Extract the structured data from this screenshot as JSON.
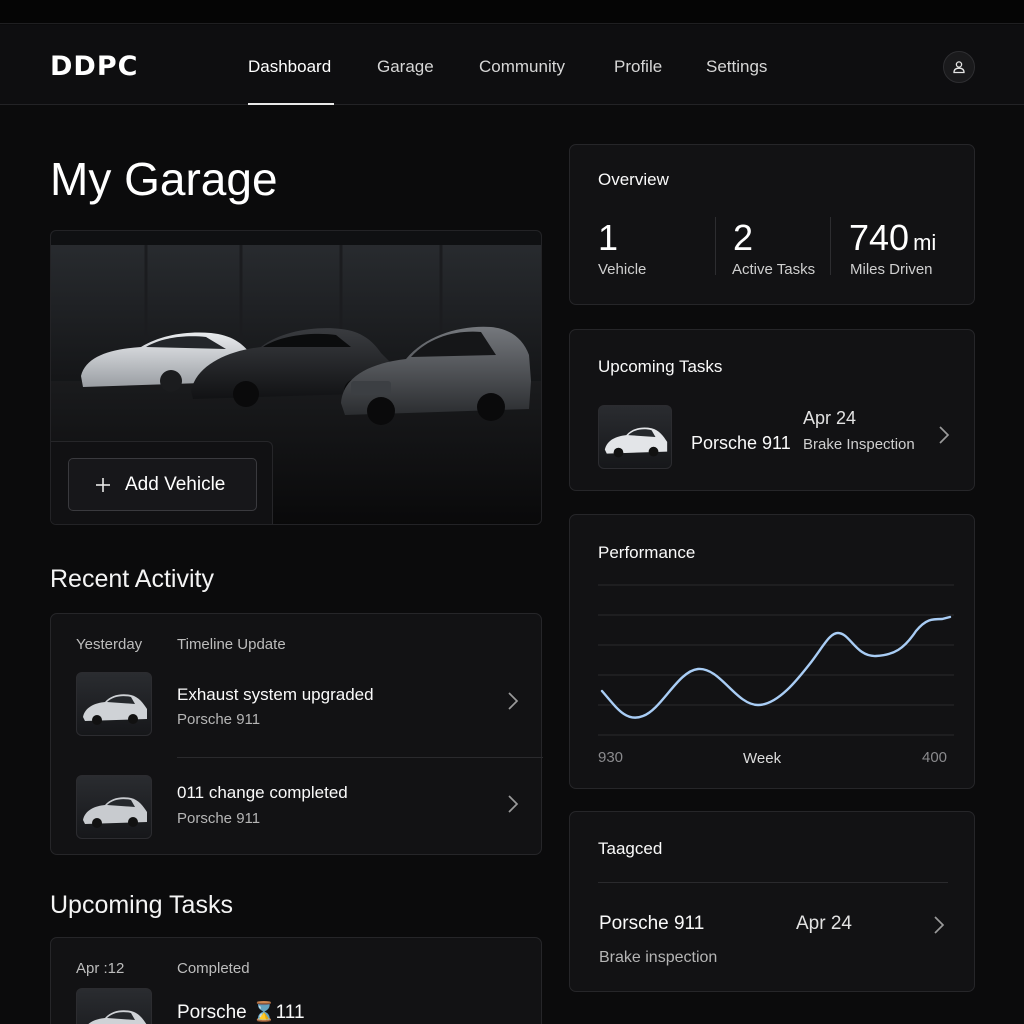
{
  "app": {
    "logo": "DDPC"
  },
  "nav": {
    "items": [
      {
        "label": "Dashboard",
        "active": true
      },
      {
        "label": "Garage"
      },
      {
        "label": "Community"
      },
      {
        "label": "Profile"
      },
      {
        "label": "Settings"
      }
    ],
    "profile_icon": "user-icon"
  },
  "page": {
    "title": "My Garage"
  },
  "hero": {
    "add_button": "Add Vehicle",
    "add_icon": "plus-icon"
  },
  "recent_activity": {
    "heading": "Recent Activity",
    "date": "Yesterday",
    "category": "Timeline Update",
    "items": [
      {
        "title": "Exhaust system upgraded",
        "vehicle": "Porsche 911"
      },
      {
        "title": "011 change completed",
        "vehicle": "Porsche 911"
      }
    ]
  },
  "upcoming_left": {
    "heading": "Upcoming Tasks",
    "date": "Apr :12",
    "status": "Completed",
    "vehicle": "Porsche ⌛111"
  },
  "overview": {
    "heading": "Overview",
    "stats": [
      {
        "value": "1",
        "unit": "",
        "label": "Vehicle"
      },
      {
        "value": "2",
        "unit": "",
        "label": "Active Tasks"
      },
      {
        "value": "740",
        "unit": "mi",
        "label": "Miles Driven"
      }
    ]
  },
  "upcoming_tasks": {
    "heading": "Upcoming Tasks",
    "vehicle": "Porsche 911",
    "date": "Apr 24",
    "task": "Brake Inspection"
  },
  "performance": {
    "heading": "Performance",
    "x_start": "930",
    "x_label": "Week",
    "x_end": "400",
    "line_color": "#a9cdf5"
  },
  "tagged": {
    "heading": "Taagced",
    "vehicle": "Porsche 911",
    "date": "Apr 24",
    "task": "Brake inspection"
  },
  "colors": {
    "background": "#0b0b0c",
    "card": "#121214",
    "border": "#262629",
    "accent_line": "#a9cdf5"
  }
}
